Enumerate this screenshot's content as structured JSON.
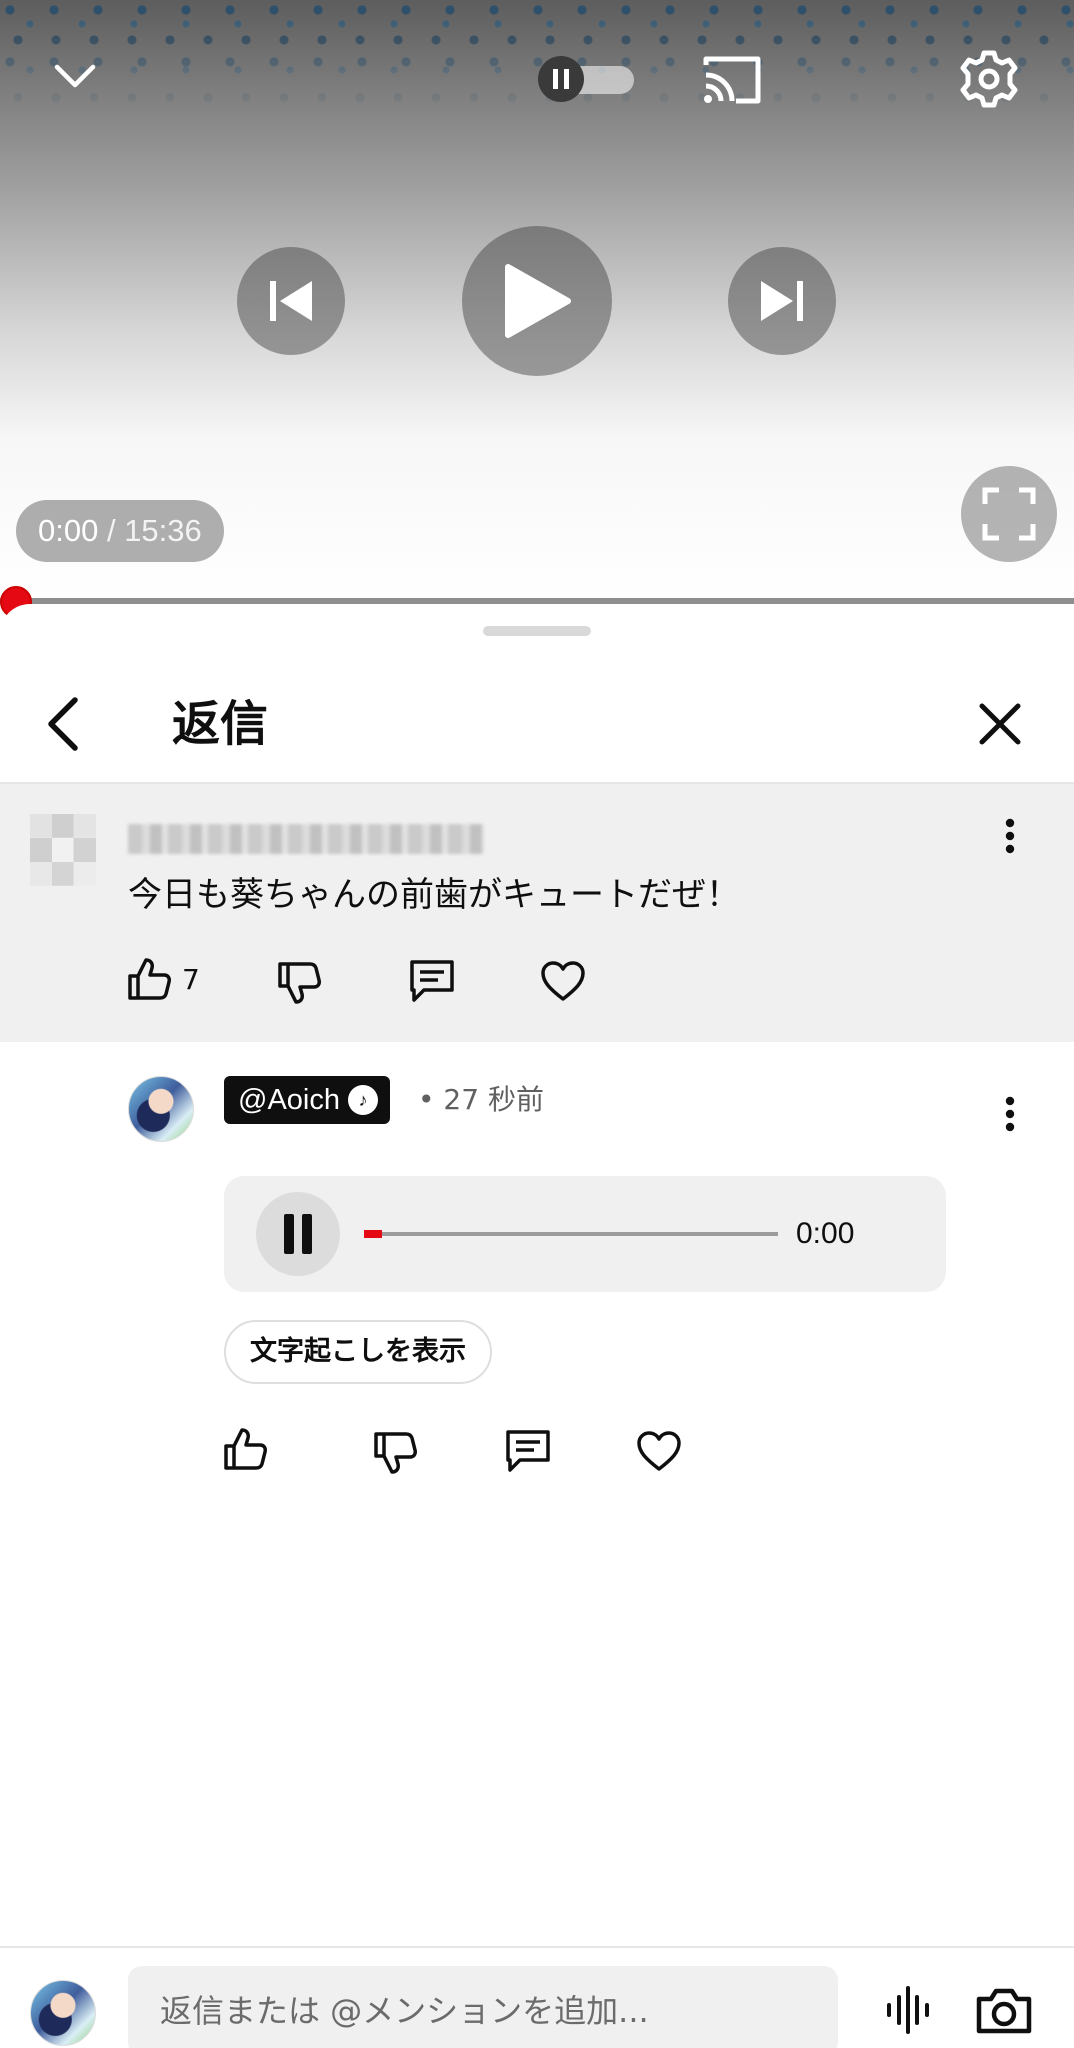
{
  "player": {
    "current_time": "0:00",
    "duration": "15:36",
    "separator": " / ",
    "progress_fraction": 0.0,
    "autoplay_on": true
  },
  "sheet": {
    "title": "返信"
  },
  "parent_comment": {
    "author_obscured": true,
    "text": "今日も葵ちゃんの前歯がキュートだぜ！",
    "like_count": "7"
  },
  "reply": {
    "channel": "@Aoich",
    "verified_icon": "music-note-verified-icon",
    "bullet": "•",
    "time_ago": "27 秒前",
    "voice_time": "0:00",
    "voice_progress_fraction": 0.02,
    "transcript_label": "文字起こしを表示"
  },
  "input_bar": {
    "placeholder": "返信または @メンションを追加..."
  },
  "colors": {
    "accent_red": "#e50914",
    "sheet_gray": "#f0f0f0",
    "text_primary": "#0f0f0f",
    "text_secondary": "#606060"
  }
}
